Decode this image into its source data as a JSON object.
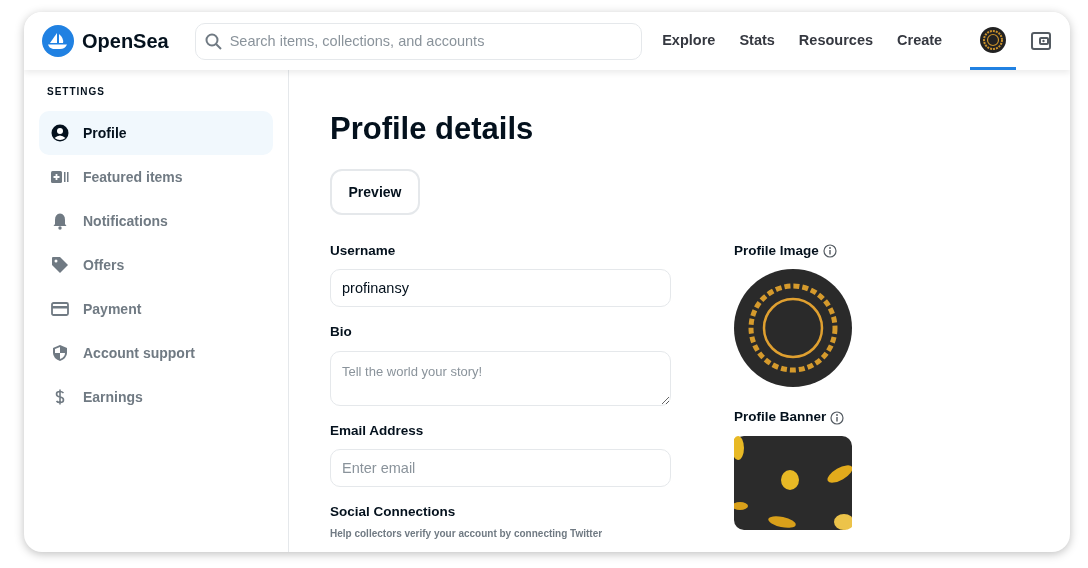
{
  "logo": {
    "name": "OpenSea"
  },
  "search": {
    "placeholder": "Search items, collections, and accounts"
  },
  "nav": [
    {
      "label": "Explore",
      "selected": false
    },
    {
      "label": "Stats",
      "selected": false
    },
    {
      "label": "Resources",
      "selected": false
    },
    {
      "label": "Create",
      "selected": false
    }
  ],
  "account": {
    "selected": true
  },
  "sidebar": {
    "heading": "SETTINGS",
    "items": [
      {
        "label": "Profile",
        "selected": true
      },
      {
        "label": "Featured items",
        "selected": false
      },
      {
        "label": "Notifications",
        "selected": false
      },
      {
        "label": "Offers",
        "selected": false
      },
      {
        "label": "Payment",
        "selected": false
      },
      {
        "label": "Account support",
        "selected": false
      },
      {
        "label": "Earnings",
        "selected": false
      }
    ]
  },
  "main": {
    "title": "Profile details",
    "preview_button": "Preview",
    "fields": [
      {
        "kind": "input",
        "label": "Username",
        "value": "profinansy"
      },
      {
        "kind": "textarea",
        "label": "Bio",
        "placeholder": "Tell the world your story!"
      },
      {
        "kind": "input",
        "label": "Email Address",
        "placeholder": "Enter email"
      }
    ],
    "social": {
      "title": "Social Connections",
      "hint": "Help collectors verify your account by connecting Twitter"
    },
    "profile_image": {
      "label": "Profile Image"
    },
    "profile_banner": {
      "label": "Profile Banner"
    }
  }
}
